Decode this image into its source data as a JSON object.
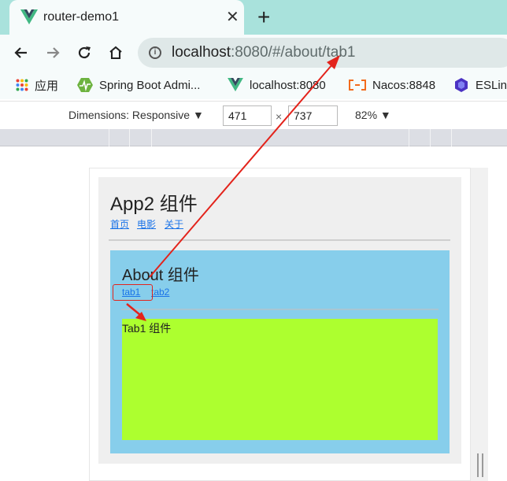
{
  "browser": {
    "tab_title": "router-demo1",
    "tab_close": "✕",
    "new_tab": "+",
    "url_host": "localhost",
    "url_rest": ":8080/#/about/tab1"
  },
  "bookmarks": [
    {
      "label": "应用",
      "icon": "apps-grid-icon"
    },
    {
      "label": "Spring Boot Admi...",
      "icon": "spring-boot-admin-icon"
    },
    {
      "label": "localhost:8080",
      "icon": "vue-logo-icon"
    },
    {
      "label": "Nacos:8848",
      "icon": "nacos-icon"
    },
    {
      "label": "ESLin",
      "icon": "eslint-icon"
    }
  ],
  "devtools": {
    "dimensions_label": "Dimensions: Responsive ▼",
    "width": "471",
    "height": "737",
    "times": "×",
    "zoom": "82% ▼"
  },
  "page": {
    "app_title": "App2 组件",
    "nav": [
      "首页",
      "电影",
      "关于"
    ],
    "about_title": "About 组件",
    "sub_tabs": [
      "tab1",
      "tab2"
    ],
    "tab_content": "Tab1 组件"
  },
  "colors": {
    "about_bg": "#87ceeb",
    "tab_bg": "#adff2f",
    "annotation": "#e3231b"
  }
}
